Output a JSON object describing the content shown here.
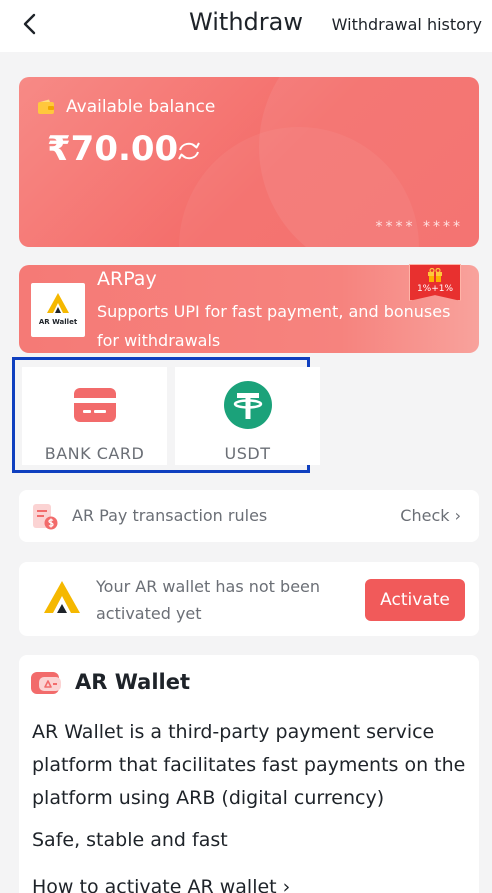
{
  "header": {
    "title": "Withdraw",
    "history_label": "Withdrawal history"
  },
  "balance": {
    "label": "Available balance",
    "amount": "₹70.00",
    "card_mask": "****  ****"
  },
  "arpay": {
    "name": "ARPay",
    "description": "Supports UPI for fast payment, and bonuses for withdrawals",
    "logo_text": "AR Wallet",
    "bonus": "1%+1%"
  },
  "methods": [
    {
      "label": "BANK CARD",
      "icon": "bank-card-icon"
    },
    {
      "label": "USDT",
      "icon": "usdt-icon"
    }
  ],
  "rules": {
    "label": "AR Pay transaction rules",
    "check_label": "Check ›"
  },
  "activate": {
    "message": "Your AR wallet has not been activated yet",
    "button_label": "Activate"
  },
  "info": {
    "title": "AR Wallet",
    "description": "AR Wallet is a third-party payment service platform that facilitates fast payments on the platform using ARB (digital currency)",
    "feature": "Safe, stable and fast",
    "link": "How to activate AR wallet ›"
  },
  "colors": {
    "accent": "#f46d6a",
    "button": "#f15a5a",
    "usdt": "#1ba27a",
    "highlight_border": "#0f3fbf"
  }
}
